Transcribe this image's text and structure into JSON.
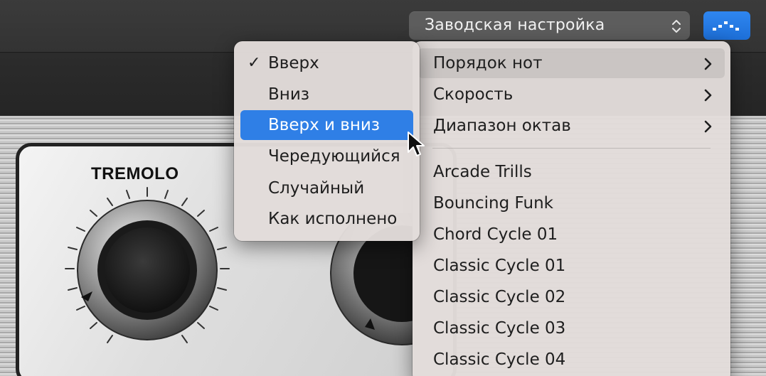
{
  "toolbar": {
    "preset_value": "Заводская настройка",
    "updown_icon": "updown-arrows-icon",
    "arp_icon": "arpeggiator-icon",
    "accent_color": "#2277e8"
  },
  "plugin": {
    "panel_title": "TREMOLO"
  },
  "main_menu": {
    "items": [
      {
        "label": "Порядок нот",
        "has_submenu": true
      },
      {
        "label": "Скорость",
        "has_submenu": true
      },
      {
        "label": "Диапазон октав",
        "has_submenu": true
      }
    ],
    "presets": [
      "Arcade Trills",
      "Bouncing Funk",
      "Chord Cycle 01",
      "Classic Cycle 01",
      "Classic Cycle 02",
      "Classic Cycle 03",
      "Classic Cycle 04"
    ]
  },
  "sub_menu": {
    "items": [
      {
        "label": "Вверх",
        "checked": true
      },
      {
        "label": "Вниз"
      },
      {
        "label": "Вверх и вниз",
        "highlighted": true
      },
      {
        "label": "Чередующийся"
      },
      {
        "label": "Случайный"
      },
      {
        "label": "Как исполнено"
      }
    ],
    "checkmark": "✓"
  }
}
